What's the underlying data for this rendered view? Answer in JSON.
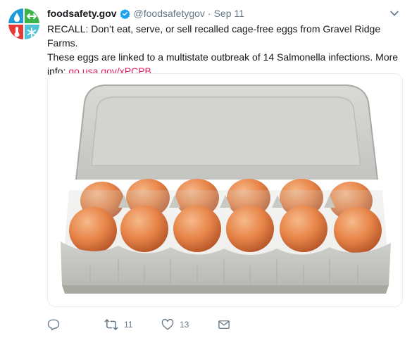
{
  "tweet": {
    "display_name": "foodsafety.gov",
    "handle": "@foodsafetygov",
    "separator": "·",
    "timestamp": "Sep 11",
    "text_line_1": "RECALL: Don’t eat, serve, or sell recalled cage-free eggs from Gravel Ridge Farms.",
    "text_line_2": "These eggs are linked to a multistate outbreak of 14 Salmonella infections. More",
    "text_line_3_prefix": "info: ",
    "link_text": "go.usa.gov/xPCPB",
    "media": {
      "description_icon": "egg-carton-photo"
    },
    "actions": {
      "reply_icon": "reply-icon",
      "retweet_icon": "retweet-icon",
      "retweet_count": "11",
      "like_icon": "heart-icon",
      "like_count": "13",
      "dm_icon": "envelope-icon"
    }
  },
  "colors": {
    "link": "#e0245e",
    "verified": "#1da1f2",
    "secondary_text": "#657786",
    "primary_text": "#14171a",
    "border": "#e6ecf0"
  }
}
